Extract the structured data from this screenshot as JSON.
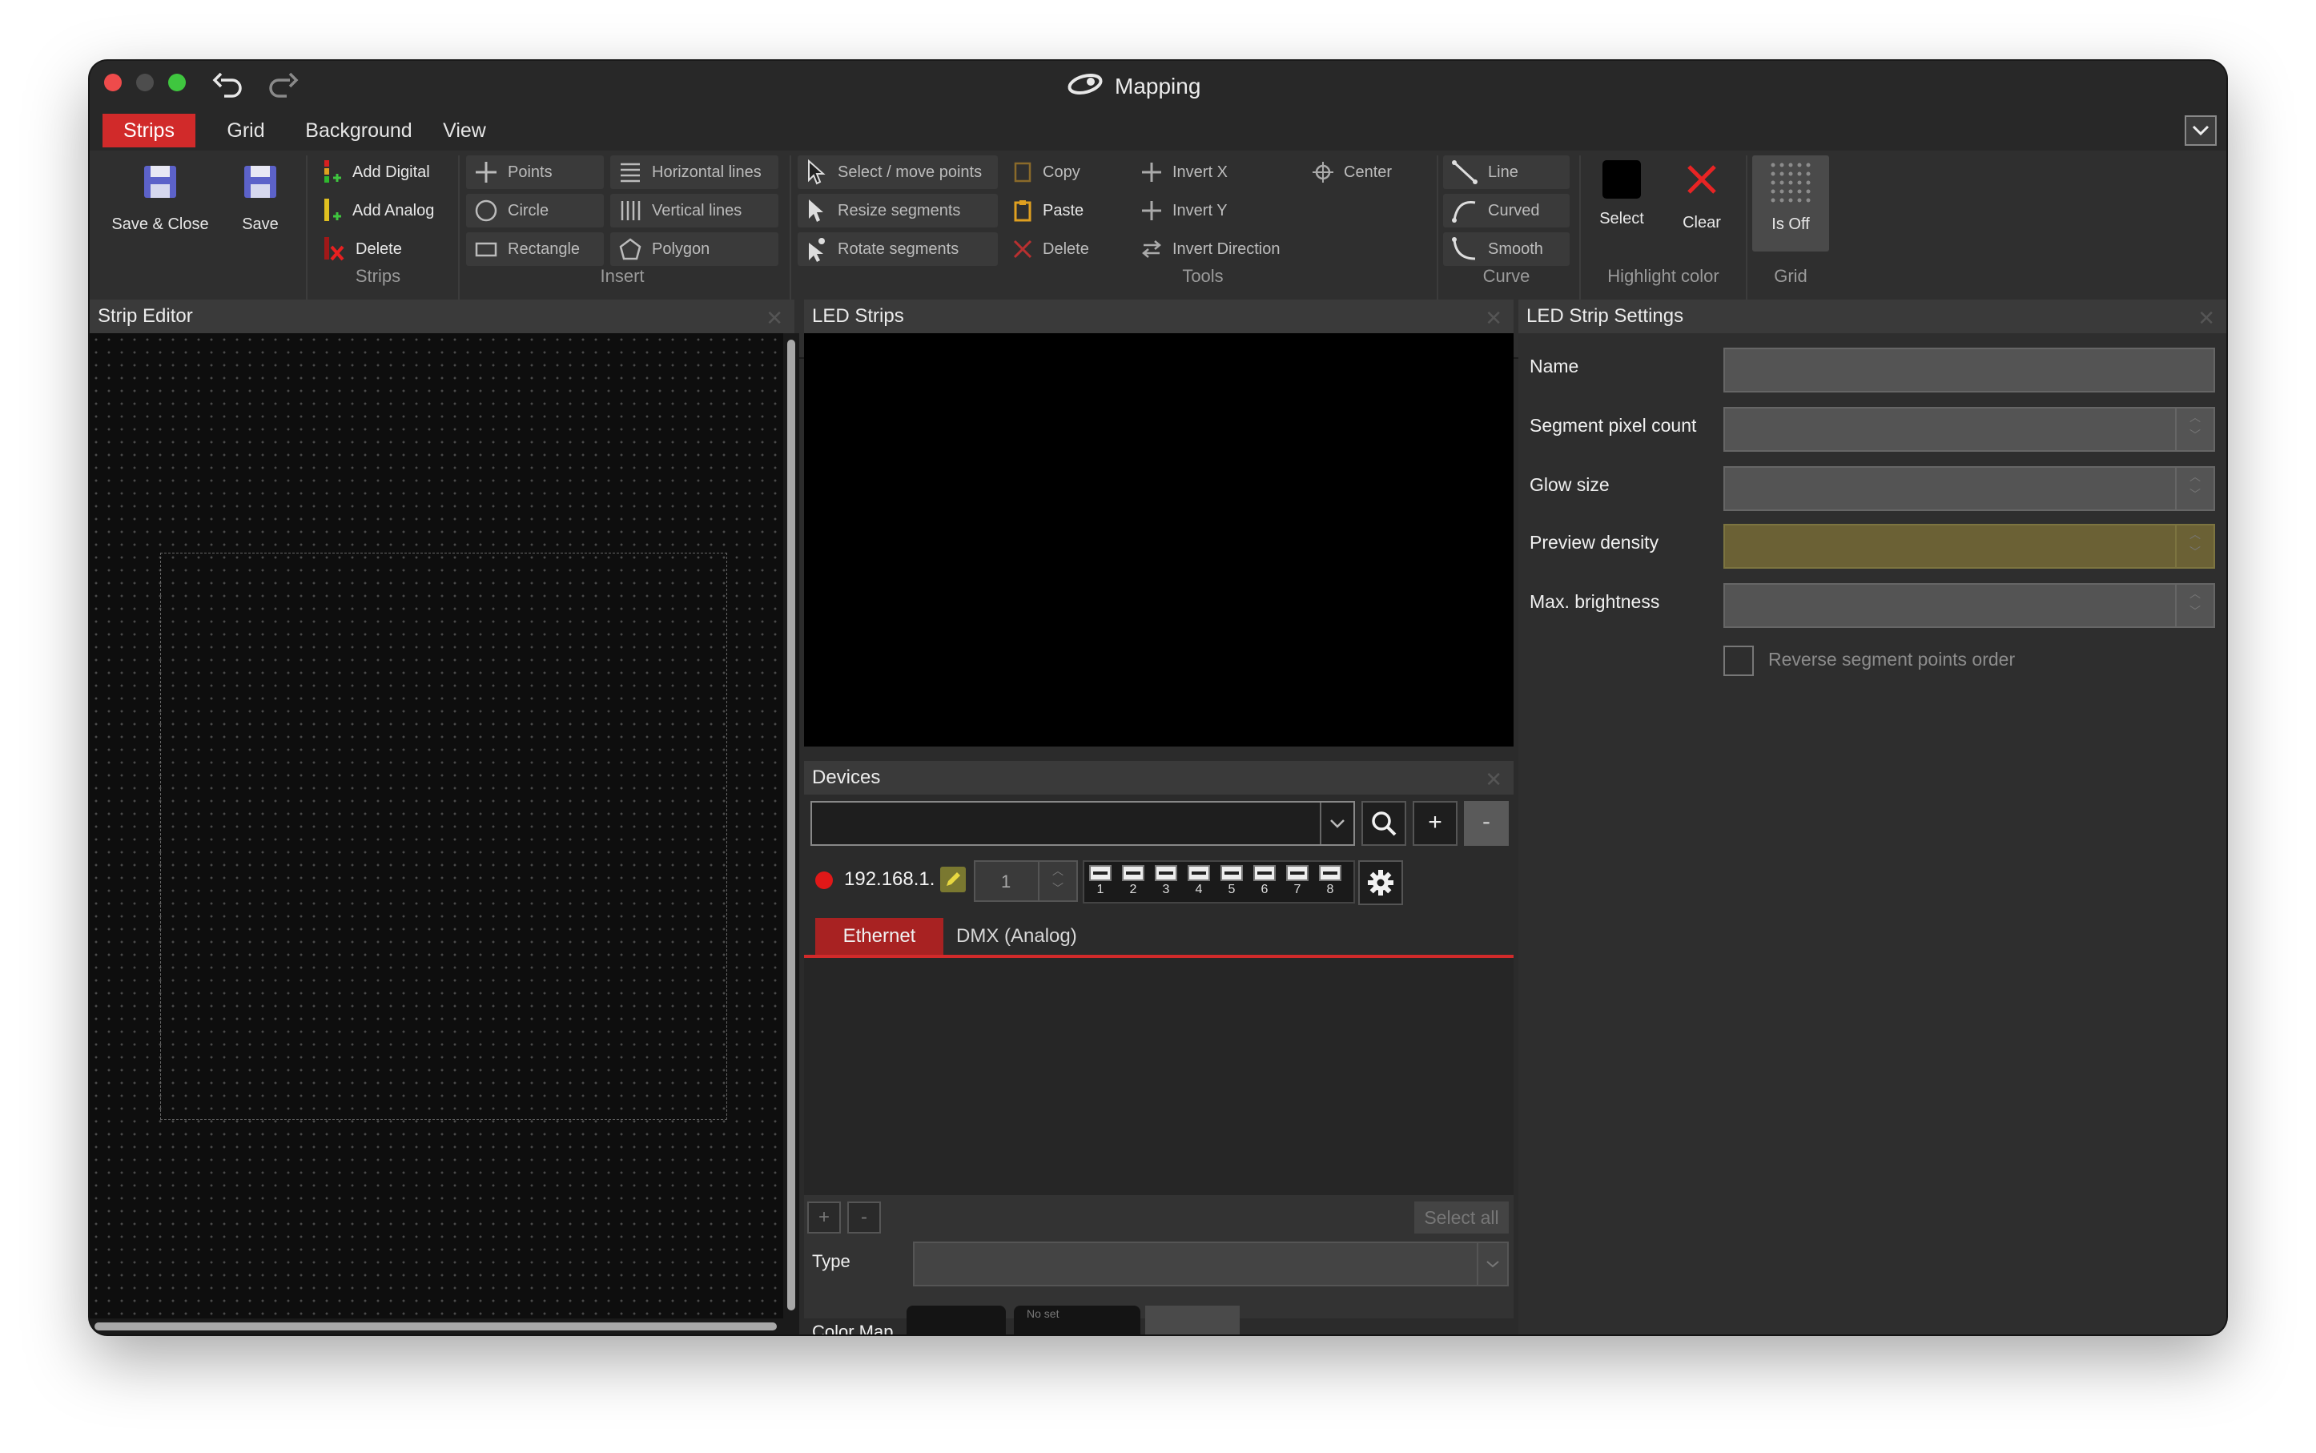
{
  "window": {
    "title": "Mapping"
  },
  "menu": {
    "tabs": [
      "Strips",
      "Grid",
      "Background",
      "View"
    ],
    "active": "Strips"
  },
  "ribbon": {
    "file": {
      "save_close": "Save & Close",
      "save": "Save"
    },
    "strips": {
      "add_digital": "Add Digital",
      "add_analog": "Add Analog",
      "delete": "Delete",
      "group": "Strips"
    },
    "insert": {
      "points": "Points",
      "horizontal_lines": "Horizontal lines",
      "circle": "Circle",
      "vertical_lines": "Vertical lines",
      "rectangle": "Rectangle",
      "polygon": "Polygon",
      "group": "Insert"
    },
    "tools": {
      "select_move": "Select / move points",
      "resize": "Resize segments",
      "rotate": "Rotate segments",
      "copy": "Copy",
      "paste": "Paste",
      "delete": "Delete",
      "invert_x": "Invert X",
      "invert_y": "Invert Y",
      "invert_direction": "Invert Direction",
      "center": "Center",
      "group": "Tools"
    },
    "curve": {
      "line": "Line",
      "curved": "Curved",
      "smooth": "Smooth",
      "group": "Curve"
    },
    "highlight": {
      "select": "Select",
      "clear": "Clear",
      "group": "Highlight color"
    },
    "grid": {
      "is_off": "Is Off",
      "group": "Grid"
    }
  },
  "panels": {
    "strip_editor": {
      "title": "Strip Editor"
    },
    "led_strips": {
      "title": "LED Strips"
    },
    "devices": {
      "title": "Devices",
      "device_ip": "192.168.1.",
      "universe": "1",
      "channels": [
        "1",
        "2",
        "3",
        "4",
        "5",
        "6",
        "7",
        "8"
      ],
      "tabs": [
        "Ethernet",
        "DMX (Analog)"
      ],
      "active_tab": "Ethernet",
      "select_all": "Select all",
      "plus": "+",
      "minus": "-",
      "type_label": "Type",
      "color_map_label": "Color Map",
      "no_set": "No set"
    },
    "settings": {
      "title": "LED Strip Settings",
      "name": "Name",
      "segment_pixel_count": "Segment pixel count",
      "glow_size": "Glow size",
      "preview_density": "Preview density",
      "max_brightness": "Max. brightness",
      "reverse": "Reverse segment points order"
    }
  },
  "colors": {
    "accent": "#d12a2a",
    "status_dot": "#e01818",
    "highlight_field": "#6b6135"
  }
}
